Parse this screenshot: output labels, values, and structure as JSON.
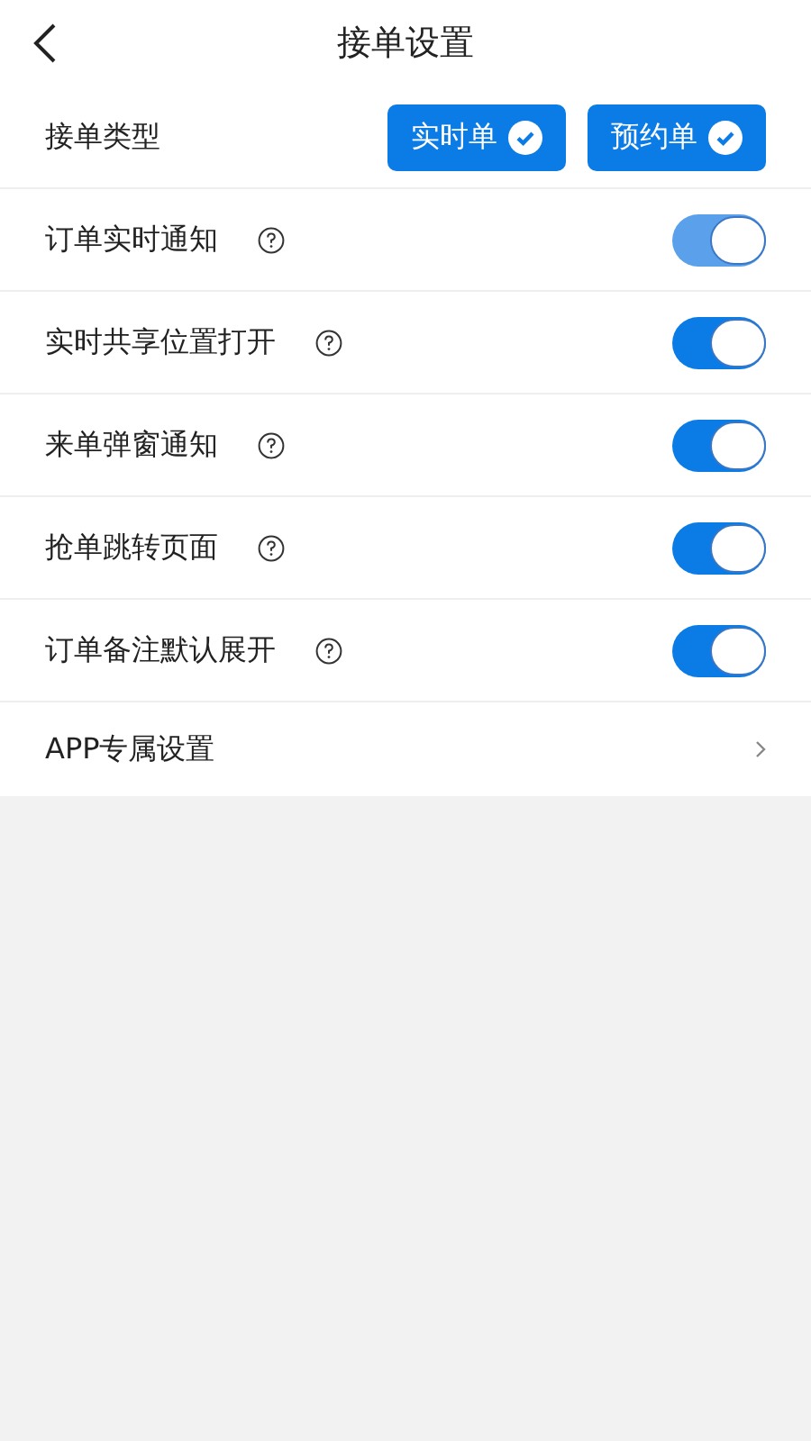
{
  "header": {
    "title": "接单设置"
  },
  "order_type": {
    "label": "接单类型",
    "options": [
      {
        "label": "实时单",
        "selected": true
      },
      {
        "label": "预约单",
        "selected": true
      }
    ]
  },
  "settings": [
    {
      "label": "订单实时通知",
      "on": true,
      "disabled": true
    },
    {
      "label": "实时共享位置打开",
      "on": true,
      "disabled": false
    },
    {
      "label": "来单弹窗通知",
      "on": true,
      "disabled": false
    },
    {
      "label": "抢单跳转页面",
      "on": true,
      "disabled": false
    },
    {
      "label": "订单备注默认展开",
      "on": true,
      "disabled": false
    }
  ],
  "app_settings": {
    "label": "APP专属设置"
  }
}
